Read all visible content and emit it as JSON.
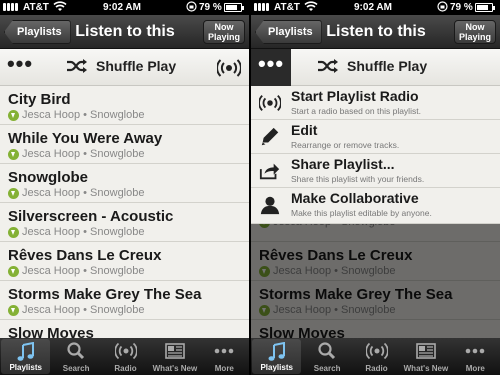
{
  "status": {
    "carrier": "AT&T",
    "time": "9:02 AM",
    "battery": "79 %",
    "battery_level": 0.79
  },
  "nav": {
    "back_label": "Playlists",
    "title": "Listen to this",
    "now_playing": "Now\nPlaying"
  },
  "actionbar": {
    "more_label": "•••",
    "shuffle_label": "Shuffle Play"
  },
  "tracks": [
    {
      "title": "City Bird",
      "artist": "Jesca Hoop",
      "album": "Snowglobe",
      "subtitle": "Jesca Hoop • Snowglobe"
    },
    {
      "title": "While You Were Away",
      "artist": "Jesca Hoop",
      "album": "Snowglobe",
      "subtitle": "Jesca Hoop • Snowglobe"
    },
    {
      "title": "Snowglobe",
      "artist": "Jesca Hoop",
      "album": "Snowglobe",
      "subtitle": "Jesca Hoop • Snowglobe"
    },
    {
      "title": "Silverscreen - Acoustic",
      "artist": "Jesca Hoop",
      "album": "Snowglobe",
      "subtitle": "Jesca Hoop • Snowglobe"
    },
    {
      "title": "Rêves Dans Le Creux",
      "artist": "Jesca Hoop",
      "album": "Snowglobe",
      "subtitle": "Jesca Hoop • Snowglobe"
    },
    {
      "title": "Storms Make Grey The Sea",
      "artist": "Jesca Hoop",
      "album": "Snowglobe",
      "subtitle": "Jesca Hoop • Snowglobe"
    },
    {
      "title": "Slow Moves",
      "artist": "",
      "album": "",
      "subtitle": ""
    }
  ],
  "menu": [
    {
      "title": "Start Playlist Radio",
      "desc": "Start a radio based on this playlist.",
      "icon": "radio-icon"
    },
    {
      "title": "Edit",
      "desc": "Rearrange or remove tracks.",
      "icon": "pencil-icon"
    },
    {
      "title": "Share Playlist...",
      "desc": "Share this playlist with your friends.",
      "icon": "share-icon"
    },
    {
      "title": "Make Collaborative",
      "desc": "Make this playlist editable by anyone.",
      "icon": "person-icon"
    }
  ],
  "tabs": [
    {
      "label": "Playlists",
      "icon": "music-note-icon"
    },
    {
      "label": "Search",
      "icon": "search-icon"
    },
    {
      "label": "Radio",
      "icon": "radio-icon"
    },
    {
      "label": "What's New",
      "icon": "news-icon"
    },
    {
      "label": "More",
      "icon": "more-dots-icon"
    }
  ],
  "active_tab": 0,
  "colors": {
    "download_green": "#84b135",
    "background": "#f1f0ec",
    "bar_dark": "#262626"
  }
}
